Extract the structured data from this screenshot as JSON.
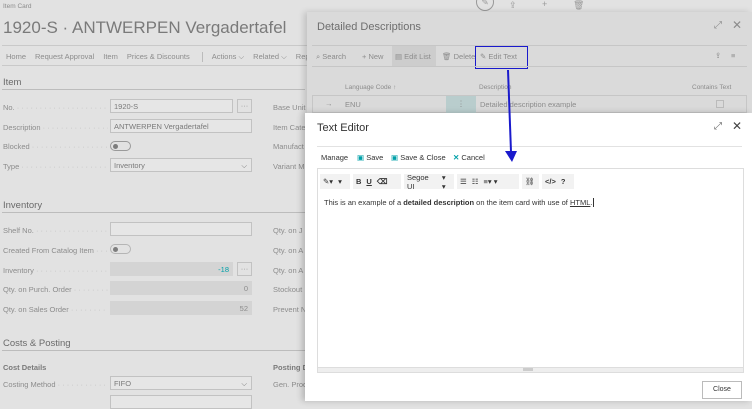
{
  "page": {
    "breadcrumb": "Item Card",
    "title": "1920-S · ANTWERPEN Vergadertafel",
    "actions": [
      "Home",
      "Request Approval",
      "Item",
      "Prices & Discounts",
      "Actions",
      "Related",
      "Repo"
    ],
    "item_section": "Item",
    "item_fields": [
      {
        "label": "No.",
        "value": "1920-S"
      },
      {
        "label": "Description",
        "value": "ANTWERPEN Vergadertafel"
      },
      {
        "label": "Blocked",
        "value": false
      },
      {
        "label": "Type",
        "value": "Inventory"
      }
    ],
    "item_right": [
      "Base Unit",
      "Item Cate",
      "Manufact",
      "Variant M"
    ],
    "inventory_section": "Inventory",
    "inventory_fields": [
      {
        "label": "Shelf No.",
        "value": ""
      },
      {
        "label": "Created From Catalog Item",
        "value": false
      },
      {
        "label": "Inventory",
        "value": "-18"
      },
      {
        "label": "Qty. on Purch. Order",
        "value": "0"
      },
      {
        "label": "Qty. on Sales Order",
        "value": "52"
      }
    ],
    "inventory_right": [
      "Qty. on J",
      "Qty. on A",
      "Qty. on A",
      "Stockout",
      "Prevent N"
    ],
    "costs_section": "Costs & Posting",
    "cost_details": "Cost Details",
    "posting_details": "Posting D",
    "costing_method_label": "Costing Method",
    "costing_method": "FIFO",
    "gen_prod": "Gen. Prod"
  },
  "detailed": {
    "title": "Detailed Descriptions",
    "toolbar": {
      "search": "Search",
      "new": "New",
      "edit_list": "Edit List",
      "delete": "Delete",
      "edit_text": "Edit Text"
    },
    "columns": [
      "Language Code ↑",
      "Description",
      "Contains Text"
    ],
    "rows": [
      {
        "language": "ENU",
        "description": "Detailed description example",
        "contains_text": false
      }
    ]
  },
  "editor": {
    "title": "Text Editor",
    "actions": {
      "manage": "Manage",
      "save": "Save",
      "save_close": "Save & Close",
      "cancel": "Cancel"
    },
    "font": "Segoe UI",
    "content": {
      "pre": "This is an example of a ",
      "bold": "detailed description",
      "mid": " on the item card with use of ",
      "link": "HTML",
      "post": "."
    },
    "close": "Close"
  },
  "colors": {
    "accent": "#00a0a8",
    "highlight": "#1a1acc"
  }
}
